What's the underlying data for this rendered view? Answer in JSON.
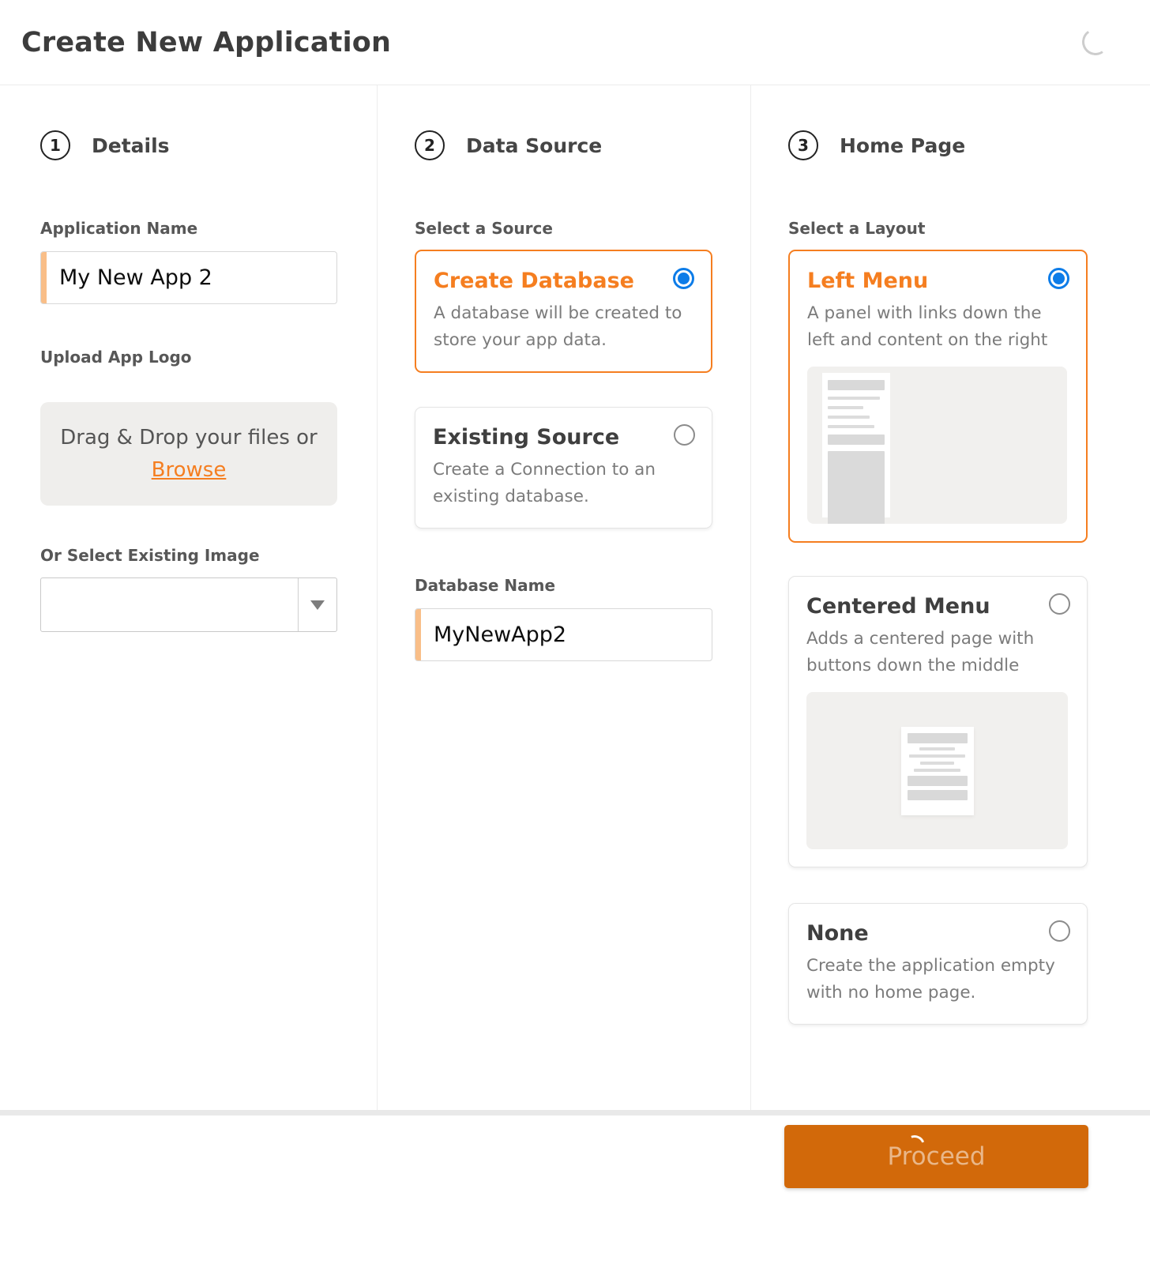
{
  "header": {
    "title": "Create New Application"
  },
  "steps": {
    "details": {
      "number": "1",
      "title": "Details"
    },
    "data_source": {
      "number": "2",
      "title": "Data Source"
    },
    "home_page": {
      "number": "3",
      "title": "Home Page"
    }
  },
  "details": {
    "app_name_label": "Application Name",
    "app_name_value": "My New App 2",
    "upload_logo_label": "Upload App Logo",
    "dropzone_text": "Drag & Drop your files or",
    "browse_label": "Browse",
    "existing_image_label": "Or Select Existing Image",
    "existing_image_value": ""
  },
  "data_source": {
    "select_source_label": "Select a Source",
    "options": [
      {
        "title": "Create Database",
        "description": "A database will be created to store your app data.",
        "selected": true
      },
      {
        "title": "Existing Source",
        "description": "Create a Connection to an existing database.",
        "selected": false
      }
    ],
    "database_name_label": "Database Name",
    "database_name_value": "MyNewApp2"
  },
  "home_page": {
    "select_layout_label": "Select a Layout",
    "options": [
      {
        "title": "Left Menu",
        "description": "A panel with links down the left and content on the right",
        "selected": true
      },
      {
        "title": "Centered Menu",
        "description": "Adds a centered page with buttons down the middle",
        "selected": false
      },
      {
        "title": "None",
        "description": "Create the application empty with no home page.",
        "selected": false
      }
    ]
  },
  "footer": {
    "proceed_label": "Proceed"
  },
  "colors": {
    "accent_orange": "#f57e20",
    "button_orange": "#d2690a",
    "radio_blue": "#0d7ce8",
    "input_accent_bar": "#f9be88"
  }
}
